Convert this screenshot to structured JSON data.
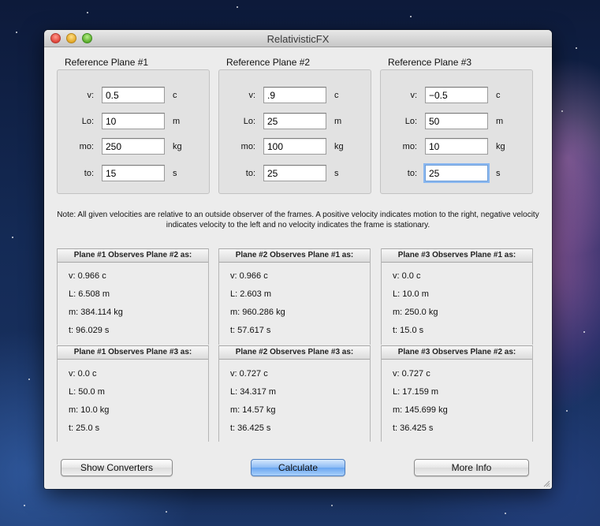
{
  "window": {
    "title": "RelativisticFX"
  },
  "planes": [
    {
      "label": "Reference Plane #1",
      "fields": [
        {
          "label": "v:",
          "value": "0.5",
          "unit": "c"
        },
        {
          "label": "Lo:",
          "value": "10",
          "unit": "m"
        },
        {
          "label": "mo:",
          "value": "250",
          "unit": "kg"
        },
        {
          "label": "to:",
          "value": "15",
          "unit": "s"
        }
      ]
    },
    {
      "label": "Reference Plane #2",
      "fields": [
        {
          "label": "v:",
          "value": ".9",
          "unit": "c"
        },
        {
          "label": "Lo:",
          "value": "25",
          "unit": "m"
        },
        {
          "label": "mo:",
          "value": "100",
          "unit": "kg"
        },
        {
          "label": "to:",
          "value": "25",
          "unit": "s"
        }
      ]
    },
    {
      "label": "Reference Plane #3",
      "fields": [
        {
          "label": "v:",
          "value": "−0.5",
          "unit": "c"
        },
        {
          "label": "Lo:",
          "value": "50",
          "unit": "m"
        },
        {
          "label": "mo:",
          "value": "10",
          "unit": "kg"
        },
        {
          "label": "to:",
          "value": "25",
          "unit": "s"
        }
      ]
    }
  ],
  "note": "Note: All given velocities are relative to an outside observer of the frames. A positive velocity indicates motion to the right, negative velocity indicates velocity to the left and no velocity indicates the frame is stationary.",
  "results": [
    {
      "header": "Plane #1 Observes Plane #2 as:",
      "lines": [
        "v: 0.966 c",
        "L: 6.508 m",
        "m: 384.114 kg",
        "t: 96.029 s"
      ]
    },
    {
      "header": "Plane #2 Observes Plane #1 as:",
      "lines": [
        "v: 0.966 c",
        "L: 2.603 m",
        "m: 960.286 kg",
        "t: 57.617 s"
      ]
    },
    {
      "header": "Plane #3 Observes Plane #1 as:",
      "lines": [
        "v: 0.0 c",
        "L: 10.0 m",
        "m: 250.0 kg",
        "t: 15.0 s"
      ]
    },
    {
      "header": "Plane #1 Observes Plane #3 as:",
      "lines": [
        "v: 0.0 c",
        "L: 50.0 m",
        "m: 10.0 kg",
        "t: 25.0 s"
      ]
    },
    {
      "header": "Plane #2 Observes Plane #3 as:",
      "lines": [
        "v: 0.727 c",
        "L: 34.317 m",
        "m: 14.57 kg",
        "t: 36.425 s"
      ]
    },
    {
      "header": "Plane #3 Observes Plane #2 as:",
      "lines": [
        "v: 0.727 c",
        "L: 17.159 m",
        "m: 145.699 kg",
        "t: 36.425 s"
      ]
    }
  ],
  "buttons": {
    "show_converters": "Show Converters",
    "calculate": "Calculate",
    "more_info": "More Info"
  }
}
